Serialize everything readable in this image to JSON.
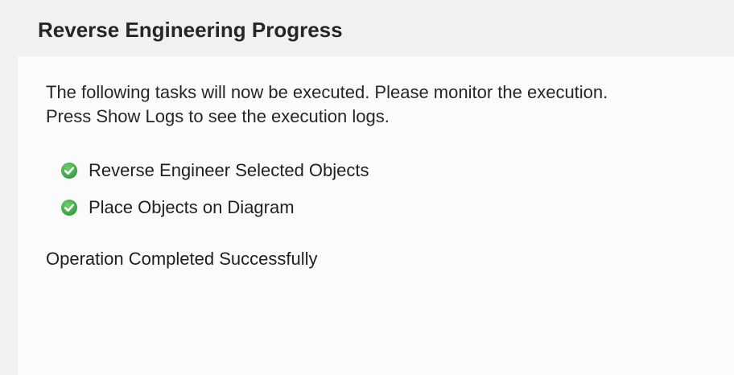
{
  "header": {
    "title": "Reverse Engineering Progress"
  },
  "main": {
    "intro_line_1": "The following tasks will now be executed. Please monitor the execution.",
    "intro_line_2": "Press Show Logs to see the execution logs.",
    "tasks": [
      {
        "label": "Reverse Engineer Selected Objects",
        "status": "completed",
        "icon": "check-circle-icon"
      },
      {
        "label": "Place Objects on Diagram",
        "status": "completed",
        "icon": "check-circle-icon"
      }
    ],
    "status_text": "Operation Completed Successfully"
  },
  "colors": {
    "header_bg": "#f2f1ef",
    "content_bg": "#fbfbfb",
    "check_green": "#3fae49"
  }
}
